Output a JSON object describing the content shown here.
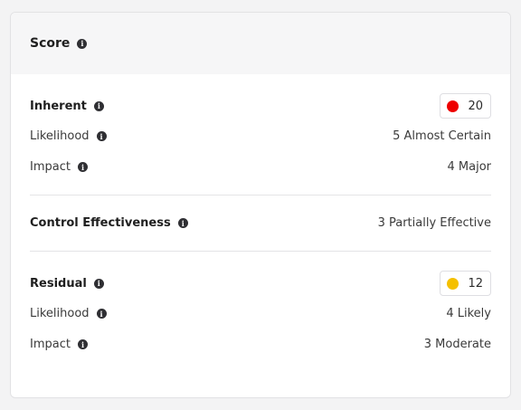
{
  "card": {
    "title": "Score"
  },
  "inherent": {
    "label": "Inherent",
    "score": "20",
    "score_color": "#ee0000",
    "likelihood_label": "Likelihood",
    "likelihood_value": "5 Almost Certain",
    "impact_label": "Impact",
    "impact_value": "4 Major"
  },
  "control": {
    "label": "Control Effectiveness",
    "value": "3 Partially Effective"
  },
  "residual": {
    "label": "Residual",
    "score": "12",
    "score_color": "#f5c000",
    "likelihood_label": "Likelihood",
    "likelihood_value": "4 Likely",
    "impact_label": "Impact",
    "impact_value": "3 Moderate"
  },
  "icons": {
    "info": "info-icon",
    "info_glyph": "i"
  }
}
